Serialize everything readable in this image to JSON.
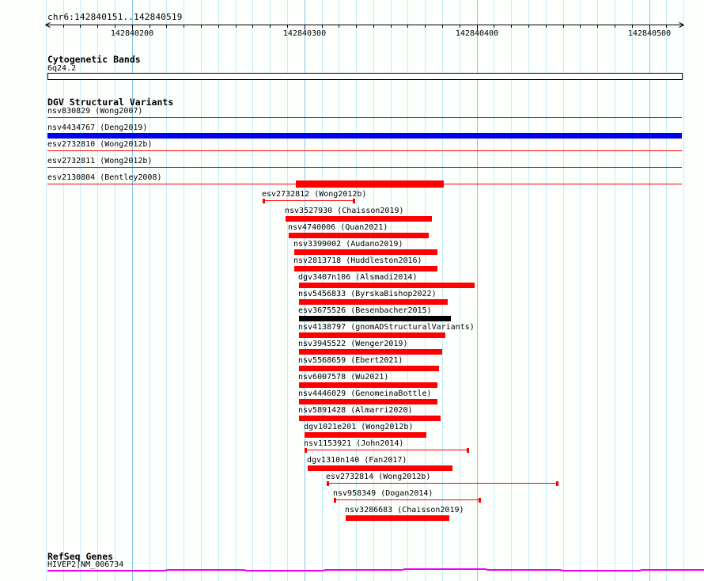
{
  "ruler": {
    "title": "chr6:142840151..142840519",
    "chrom": "chr6",
    "start": 142840151,
    "end": 142840519,
    "minor_step": 10,
    "major_step": 100,
    "major_tick_labels": [
      "142840200",
      "142840300",
      "142840400",
      "142840500"
    ],
    "major_tick_positions": [
      142840200,
      142840300,
      142840400,
      142840500
    ],
    "grid_from": 142840150,
    "grid_to": 142840520
  },
  "colors": {
    "red": "#ff0000",
    "blue": "#0000ee",
    "black": "#000000",
    "magenta": "#ee00ee",
    "grid_light": "#c6edf3",
    "grid_major": "#85c8ea",
    "axis": "#000000"
  },
  "sections": {
    "cytobands": {
      "title": "Cytogenetic Bands",
      "band_label": "6q24.2",
      "band_start": 142840151,
      "band_end": 142840519
    },
    "variants": {
      "title": "DGV Structural Variants",
      "items": [
        {
          "label": "nsv830829 (Wong2007)",
          "start": 142840151,
          "end": 142840519,
          "glyph": "line",
          "color": "red",
          "clipped": true
        },
        {
          "label": "nsv4434767 (Deng2019)",
          "start": 142840151,
          "end": 142840519,
          "glyph": "bar",
          "color": "blue",
          "clipped": true
        },
        {
          "label": "esv2732810 (Wong2012b)",
          "start": 142840151,
          "end": 142840519,
          "glyph": "line",
          "color": "red",
          "clipped": true
        },
        {
          "label": "esv2732811 (Wong2012b)",
          "start": 142840151,
          "end": 142840519,
          "glyph": "line",
          "color": "red",
          "clipped": true
        },
        {
          "label": "esv2130804 (Bentley2008)",
          "start": 142840151,
          "end": 142840519,
          "glyph": "line_bar",
          "color": "red",
          "clipped": true,
          "thick_start": 142840295,
          "thick_end": 142840381
        },
        {
          "label": "esv2732812 (Wong2012b)",
          "start": 142840276,
          "end": 142840329,
          "glyph": "whisker",
          "color": "red"
        },
        {
          "label": "nsv3527930 (Chaisson2019)",
          "start": 142840289,
          "end": 142840374,
          "glyph": "bar",
          "color": "red"
        },
        {
          "label": "nsv4740006 (Quan2021)",
          "start": 142840291,
          "end": 142840372,
          "glyph": "bar",
          "color": "red"
        },
        {
          "label": "nsv3399002 (Audano2019)",
          "start": 142840294,
          "end": 142840377,
          "glyph": "bar",
          "color": "red"
        },
        {
          "label": "nsv2813718 (Huddleston2016)",
          "start": 142840294,
          "end": 142840377,
          "glyph": "bar",
          "color": "red"
        },
        {
          "label": "dgv3407n106 (Alsmadi2014)",
          "start": 142840297,
          "end": 142840399,
          "glyph": "bar",
          "color": "red"
        },
        {
          "label": "nsv5456833 (ByrskaBishop2022)",
          "start": 142840297,
          "end": 142840383,
          "glyph": "bar",
          "color": "red"
        },
        {
          "label": "esv3675526 (Besenbacher2015)",
          "start": 142840297,
          "end": 142840385,
          "glyph": "bar",
          "color": "black"
        },
        {
          "label": "nsv4138797 (gnomADStructuralVariants)",
          "start": 142840297,
          "end": 142840382,
          "glyph": "bar",
          "color": "red"
        },
        {
          "label": "nsv3945522 (Wenger2019)",
          "start": 142840297,
          "end": 142840380,
          "glyph": "bar",
          "color": "red"
        },
        {
          "label": "nsv5568659 (Ebert2021)",
          "start": 142840297,
          "end": 142840378,
          "glyph": "bar",
          "color": "red"
        },
        {
          "label": "nsv6007578 (Wu2021)",
          "start": 142840297,
          "end": 142840377,
          "glyph": "bar",
          "color": "red"
        },
        {
          "label": "nsv4446029 (GenomeinaBottle)",
          "start": 142840297,
          "end": 142840377,
          "glyph": "bar",
          "color": "red"
        },
        {
          "label": "nsv5891428 (Almarri2020)",
          "start": 142840297,
          "end": 142840379,
          "glyph": "bar",
          "color": "red"
        },
        {
          "label": "dgv1021e201 (Wong2012b)",
          "start": 142840300,
          "end": 142840371,
          "glyph": "bar",
          "color": "red"
        },
        {
          "label": "nsv1153921 (John2014)",
          "start": 142840300,
          "end": 142840395,
          "glyph": "whisker",
          "color": "red"
        },
        {
          "label": "dgv1310n140 (Fan2017)",
          "start": 142840302,
          "end": 142840386,
          "glyph": "bar",
          "color": "red"
        },
        {
          "label": "esv2732814 (Wong2012b)",
          "start": 142840313,
          "end": 142840447,
          "glyph": "whisker",
          "color": "red"
        },
        {
          "label": "nsv958349 (Dogan2014)",
          "start": 142840317,
          "end": 142840402,
          "glyph": "whisker",
          "color": "red"
        },
        {
          "label": "nsv3286683 (Chaisson2019)",
          "start": 142840324,
          "end": 142840384,
          "glyph": "bar",
          "color": "red"
        }
      ]
    },
    "genes": {
      "title": "RefSeq Genes",
      "gene_label": "HIVEP2|NM_006734",
      "clipped": true
    }
  }
}
